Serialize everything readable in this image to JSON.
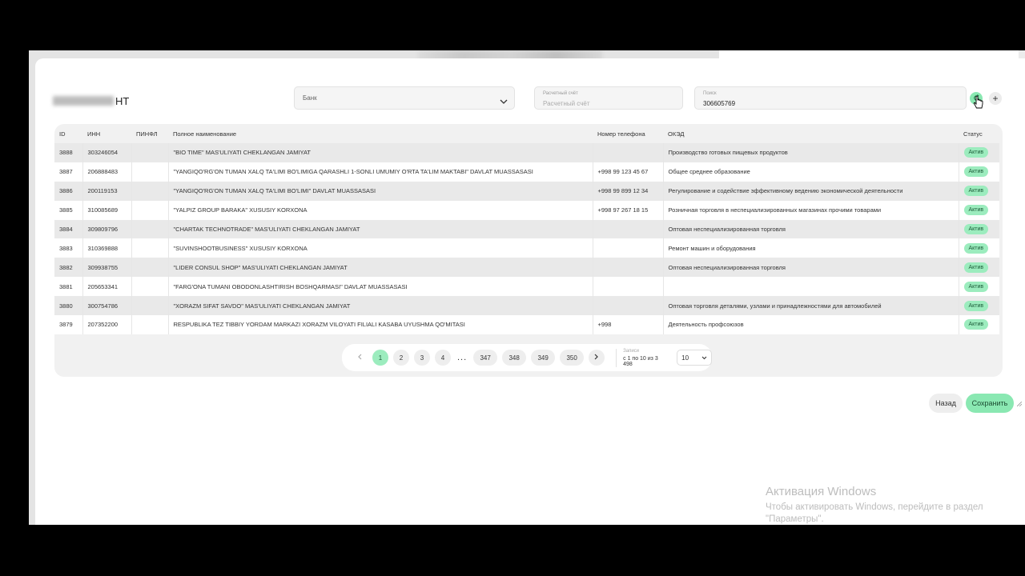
{
  "header": {
    "title_suffix": "НТ"
  },
  "filters": {
    "bank": {
      "placeholder": "Банк",
      "icon": "chevron-down-icon"
    },
    "account": {
      "label": "Расчетный счёт",
      "placeholder": "Расчетный счёт"
    },
    "search": {
      "label": "Поиск",
      "value": "306605769"
    },
    "refresh_icon": "refresh-icon",
    "add_icon": "plus-icon"
  },
  "table": {
    "columns": {
      "id": "ID",
      "inn": "ИНН",
      "pinfl": "ПИНФЛ",
      "name": "Полное наименование",
      "phone": "Номер телефона",
      "oked": "ОКЭД",
      "status": "Статус"
    },
    "rows": [
      {
        "id": "3888",
        "inn": "303246054",
        "pinfl": "",
        "name": "\"BIO TIME\" MAS'ULIYATI CHEKLANGAN JAMIYAT",
        "phone": "",
        "oked": "Производство готовых пищевых продуктов",
        "status": "Актив"
      },
      {
        "id": "3887",
        "inn": "206888483",
        "pinfl": "",
        "name": "\"YANGIQO'RG'ON TUMAN XALQ TA'LIMI BO'LIMIGA QARASHLI 1-SONLI UMUMIY O'RTA TA'LIM MAKTABI\" DAVLAT MUASSASASI",
        "phone": "+998 99 123 45 67",
        "oked": "Общее среднее образование",
        "status": "Актив"
      },
      {
        "id": "3886",
        "inn": "200119153",
        "pinfl": "",
        "name": "\"YANGIQO'RG'ON TUMAN XALQ TA'LIMI BO'LIMI\" DAVLAT MUASSASASI",
        "phone": "+998 99 899 12 34",
        "oked": "Регулирование и содействие эффективному ведению экономической деятельности",
        "status": "Актив"
      },
      {
        "id": "3885",
        "inn": "310085689",
        "pinfl": "",
        "name": "\"YALPIZ GROUP BARAKA\" XUSUSIY KORXONA",
        "phone": "+998 97 267 18 15",
        "oked": "Розничная торговля в неспециализированных магазинах прочими товарами",
        "status": "Актив"
      },
      {
        "id": "3884",
        "inn": "309809796",
        "pinfl": "",
        "name": "\"CHARTAK TECHNOTRADE\" MAS'ULIYATI CHEKLANGAN JAMIYAT",
        "phone": "",
        "oked": "Оптовая неспециализированная торговля",
        "status": "Актив"
      },
      {
        "id": "3883",
        "inn": "310369888",
        "pinfl": "",
        "name": "\"SUVINSHOOTBUSINESS\" XUSUSIY KORXONA",
        "phone": "",
        "oked": "Ремонт машин и оборудования",
        "status": "Актив"
      },
      {
        "id": "3882",
        "inn": "309938755",
        "pinfl": "",
        "name": "\"LIDER CONSUL SHOP\" MAS'ULIYATI CHEKLANGAN JAMIYAT",
        "phone": "",
        "oked": "Оптовая неспециализированная торговля",
        "status": "Актив"
      },
      {
        "id": "3881",
        "inn": "205653341",
        "pinfl": "",
        "name": "\"FARG'ONA TUMANI OBODONLASHTIRISH BOSHQARMASI\" DAVLAT MUASSASASI",
        "phone": "",
        "oked": "",
        "status": "Актив"
      },
      {
        "id": "3880",
        "inn": "300754786",
        "pinfl": "",
        "name": "\"XORAZM SIFAT SAVDO\" MAS'ULIYATI CHEKLANGAN JAMIYAT",
        "phone": "",
        "oked": "Оптовая торговля деталями, узлами и принадлежностями для автомобилей",
        "status": "Актив"
      },
      {
        "id": "3879",
        "inn": "207352200",
        "pinfl": "",
        "name": "RESPUBLIKA TEZ TIBBIY YORDAM MARKAZI XORAZM VILOYATI FILIALI KASABA UYUSHMA QO'MITASI",
        "phone": "+998",
        "oked": "Деятельность профсоюзов",
        "status": "Актив"
      }
    ]
  },
  "pagination": {
    "pages": [
      "1",
      "2",
      "3",
      "4"
    ],
    "ellipsis": "...",
    "tail_pages": [
      "347",
      "348",
      "349",
      "350"
    ],
    "active": "1",
    "records_label": "Записи",
    "records_info": "с 1 по 10 из 3 498",
    "page_size": "10"
  },
  "actions": {
    "back": "Назад",
    "save": "Сохранить"
  },
  "windows_activation": {
    "title": "Активация Windows",
    "text": "Чтобы активировать Windows, перейдите в раздел \"Параметры\"."
  },
  "colors": {
    "accent": "#9cecbe",
    "accent_text": "#1d5c39"
  }
}
